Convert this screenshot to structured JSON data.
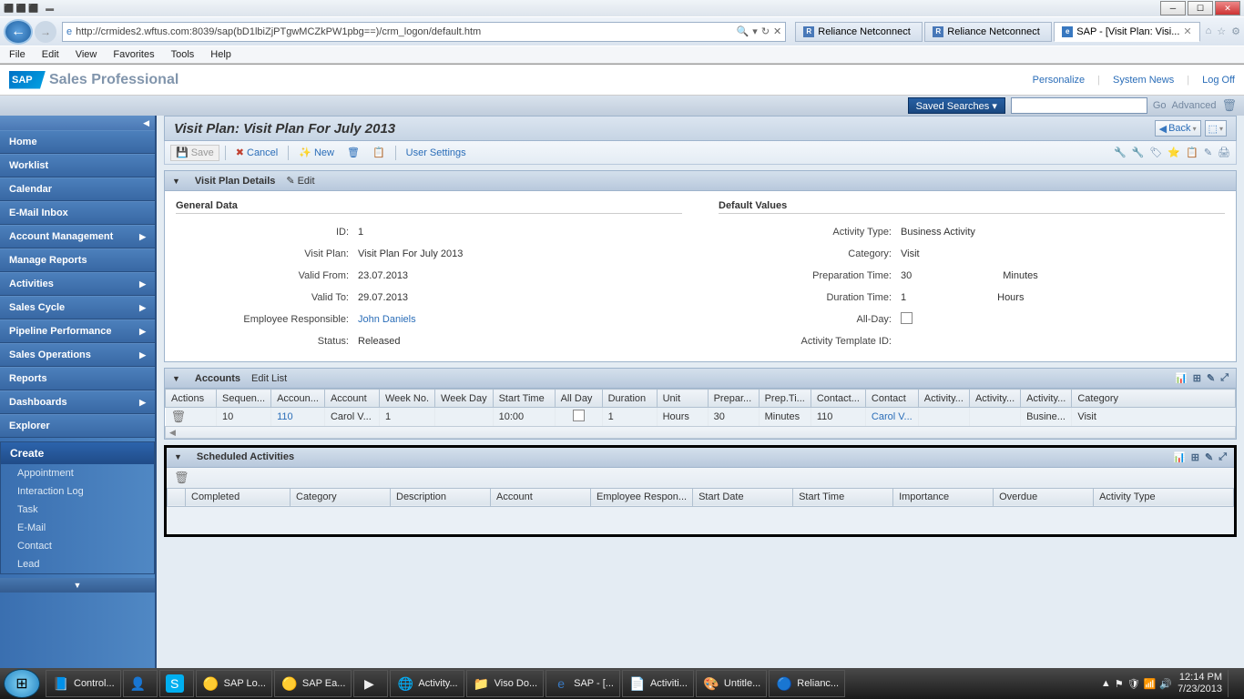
{
  "browser": {
    "url": "http://crmides2.wftus.com:8039/sap(bD1lbiZjPTgwMCZkPW1pbg==)/crm_logon/default.htm",
    "tabs": [
      {
        "icon": "R",
        "label": "Reliance Netconnect"
      },
      {
        "icon": "R",
        "label": "Reliance Netconnect"
      },
      {
        "icon": "e",
        "label": "SAP - [Visit Plan: Visi...",
        "active": true
      }
    ],
    "menus": [
      "File",
      "Edit",
      "View",
      "Favorites",
      "Tools",
      "Help"
    ]
  },
  "masthead": {
    "logo": "SAP",
    "title": "Sales Professional",
    "links": [
      "Personalize",
      "System News",
      "Log Off"
    ],
    "saved_searches": "Saved Searches ▾",
    "go": "Go",
    "advanced": "Advanced"
  },
  "sidebar": {
    "items": [
      {
        "label": "Home"
      },
      {
        "label": "Worklist"
      },
      {
        "label": "Calendar"
      },
      {
        "label": "E-Mail Inbox"
      },
      {
        "label": "Account Management",
        "arrow": true
      },
      {
        "label": "Manage Reports"
      },
      {
        "label": "Activities",
        "arrow": true
      },
      {
        "label": "Sales Cycle",
        "arrow": true
      },
      {
        "label": "Pipeline Performance",
        "arrow": true
      },
      {
        "label": "Sales Operations",
        "arrow": true
      },
      {
        "label": "Reports"
      },
      {
        "label": "Dashboards",
        "arrow": true
      },
      {
        "label": "Explorer"
      }
    ],
    "create_header": "Create",
    "create_items": [
      "Appointment",
      "Interaction Log",
      "Task",
      "E-Mail",
      "Contact",
      "Lead"
    ]
  },
  "content": {
    "title": "Visit Plan: Visit Plan For July 2013",
    "back": "Back",
    "toolbar": {
      "save": "Save",
      "cancel": "Cancel",
      "new": "New",
      "user_settings": "User Settings"
    }
  },
  "details_panel": {
    "title": "Visit Plan Details",
    "edit": "Edit",
    "general_title": "General Data",
    "default_title": "Default Values",
    "fields": {
      "id_label": "ID:",
      "id_value": "1",
      "visit_plan_label": "Visit Plan:",
      "visit_plan_value": "Visit Plan For July 2013",
      "valid_from_label": "Valid From:",
      "valid_from_value": "23.07.2013",
      "valid_to_label": "Valid To:",
      "valid_to_value": "29.07.2013",
      "emp_label": "Employee Responsible:",
      "emp_value": "John Daniels",
      "status_label": "Status:",
      "status_value": "Released",
      "activity_type_label": "Activity Type:",
      "activity_type_value": "Business Activity",
      "category_label": "Category:",
      "category_value": "Visit",
      "prep_time_label": "Preparation Time:",
      "prep_time_value": "30",
      "prep_time_unit": "Minutes",
      "duration_label": "Duration Time:",
      "duration_value": "1",
      "duration_unit": "Hours",
      "allday_label": "All-Day:",
      "template_label": "Activity Template ID:"
    }
  },
  "accounts_panel": {
    "title": "Accounts",
    "edit_list": "Edit List",
    "columns": [
      "Actions",
      "Sequen...",
      "Accoun...",
      "Account",
      "Week No.",
      "Week Day",
      "Start Time",
      "All Day",
      "Duration",
      "Unit",
      "Prepar...",
      "Prep.Ti...",
      "Contact...",
      "Contact",
      "Activity...",
      "Activity...",
      "Activity...",
      "Category"
    ],
    "row": {
      "sequence": "10",
      "account_id": "110",
      "account": "Carol V...",
      "week_no": "1",
      "week_day": "",
      "start_time": "10:00",
      "duration": "1",
      "unit": "Hours",
      "prep": "30",
      "prep_unit": "Minutes",
      "contact_id": "110",
      "contact": "Carol V...",
      "act1": "",
      "act2": "",
      "act3": "Busine...",
      "category": "Visit"
    }
  },
  "scheduled_panel": {
    "title": "Scheduled Activities",
    "columns": [
      "Completed",
      "Category",
      "Description",
      "Account",
      "Employee Respon...",
      "Start Date",
      "Start Time",
      "Importance",
      "Overdue",
      "Activity Type"
    ]
  },
  "taskbar": {
    "items": [
      {
        "icon": "📘",
        "label": "Control..."
      },
      {
        "icon": "👤",
        "label": ""
      },
      {
        "icon": "S",
        "label": ""
      },
      {
        "icon": "🟡",
        "label": "SAP Lo..."
      },
      {
        "icon": "🟡",
        "label": "SAP Ea..."
      },
      {
        "icon": "▶",
        "label": ""
      },
      {
        "icon": "🌐",
        "label": "Activity..."
      },
      {
        "icon": "📁",
        "label": "Viso Do..."
      },
      {
        "icon": "e",
        "label": "SAP - [..."
      },
      {
        "icon": "📄",
        "label": "Activiti..."
      },
      {
        "icon": "🎨",
        "label": "Untitle..."
      },
      {
        "icon": "🔵",
        "label": "Relianc..."
      }
    ],
    "time": "12:14 PM",
    "date": "7/23/2013"
  }
}
